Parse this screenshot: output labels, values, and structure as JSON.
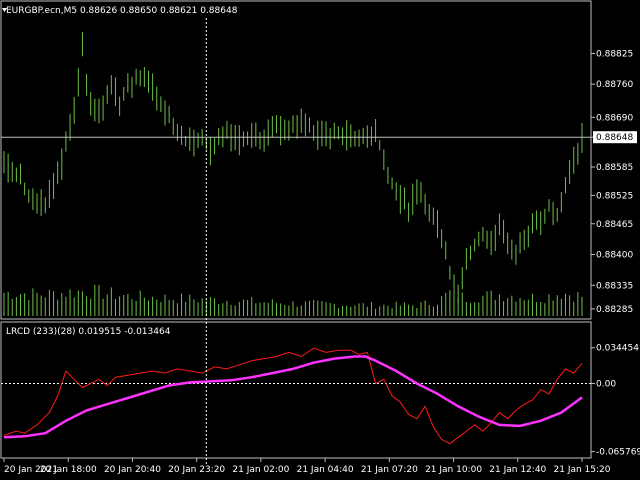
{
  "colors": {
    "background": "#000000",
    "grid_frame": "#c0c0c0",
    "candles": "#6fbf4a",
    "volume": "#6fbf4a",
    "price_line": "#c0c0c0",
    "crosshair": "#ffffff",
    "lrcd_line": "#ff1a1a",
    "signal_line": "#ff33ff",
    "price_label_bg": "#ffffff",
    "price_label_text": "#000000"
  },
  "main_panel": {
    "title": "EURGBP.ecn,M5  0.88626 0.88650 0.88621 0.88648",
    "current_price_label": "0.88648"
  },
  "indicator_panel": {
    "title": "LRCD (233)(28) 0.019515 -0.013464"
  },
  "chart_data": [
    {
      "type": "bar",
      "title": "EURGBP.ecn,M5  0.88626 0.88650 0.88621 0.88648",
      "series_type": "ohlc-bars",
      "ylim": [
        0.8827,
        0.889
      ],
      "y_ticks": [
        "0.88825",
        "0.88760",
        "0.88690",
        "0.88648",
        "0.88585",
        "0.88525",
        "0.88465",
        "0.88400",
        "0.88335",
        "0.88285"
      ],
      "y_tick_values": [
        0.88825,
        0.8876,
        0.8869,
        0.88648,
        0.88585,
        0.88525,
        0.88465,
        0.884,
        0.88335,
        0.88285
      ],
      "current_price": 0.88648,
      "close_path": [
        [
          0,
          0.8859
        ],
        [
          4,
          0.8857
        ],
        [
          8,
          0.8856
        ],
        [
          12,
          0.8852
        ],
        [
          16,
          0.8851
        ],
        [
          20,
          0.885
        ],
        [
          24,
          0.8855
        ],
        [
          28,
          0.8859
        ],
        [
          30,
          0.8864
        ],
        [
          34,
          0.887
        ],
        [
          36,
          0.8876
        ],
        [
          38,
          0.8884
        ],
        [
          40,
          0.8877
        ],
        [
          42,
          0.8872
        ],
        [
          46,
          0.887
        ],
        [
          50,
          0.8873
        ],
        [
          52,
          0.8876
        ],
        [
          56,
          0.8872
        ],
        [
          60,
          0.8876
        ],
        [
          64,
          0.8877
        ],
        [
          68,
          0.8877
        ],
        [
          72,
          0.8875
        ],
        [
          76,
          0.8872
        ],
        [
          80,
          0.8869
        ],
        [
          84,
          0.8866
        ],
        [
          88,
          0.8864
        ],
        [
          92,
          0.8864
        ],
        [
          96,
          0.8865
        ],
        [
          100,
          0.8862
        ],
        [
          104,
          0.8865
        ],
        [
          108,
          0.8866
        ],
        [
          112,
          0.8864
        ],
        [
          116,
          0.8864
        ],
        [
          120,
          0.8865
        ],
        [
          124,
          0.8864
        ],
        [
          128,
          0.8866
        ],
        [
          132,
          0.8867
        ],
        [
          136,
          0.8866
        ],
        [
          140,
          0.8867
        ],
        [
          144,
          0.8868
        ],
        [
          148,
          0.8867
        ],
        [
          152,
          0.8865
        ],
        [
          156,
          0.8865
        ],
        [
          160,
          0.8866
        ],
        [
          164,
          0.8865
        ],
        [
          168,
          0.8865
        ],
        [
          172,
          0.8865
        ],
        [
          176,
          0.8865
        ],
        [
          180,
          0.8866
        ],
        [
          184,
          0.886
        ],
        [
          188,
          0.8855
        ],
        [
          192,
          0.8852
        ],
        [
          196,
          0.885
        ],
        [
          200,
          0.8853
        ],
        [
          204,
          0.8851
        ],
        [
          208,
          0.8848
        ],
        [
          212,
          0.8844
        ],
        [
          216,
          0.8836
        ],
        [
          220,
          0.8832
        ],
        [
          224,
          0.8838
        ],
        [
          228,
          0.8842
        ],
        [
          232,
          0.8844
        ],
        [
          236,
          0.8842
        ],
        [
          240,
          0.8846
        ],
        [
          244,
          0.8843
        ],
        [
          248,
          0.884
        ],
        [
          252,
          0.8843
        ],
        [
          256,
          0.8846
        ],
        [
          260,
          0.8847
        ],
        [
          264,
          0.885
        ],
        [
          268,
          0.8848
        ],
        [
          272,
          0.8854
        ],
        [
          276,
          0.886
        ],
        [
          280,
          0.88648
        ]
      ],
      "volume_path": [
        [
          0,
          26
        ],
        [
          20,
          24
        ],
        [
          40,
          28
        ],
        [
          60,
          22
        ],
        [
          80,
          20
        ],
        [
          100,
          18
        ],
        [
          120,
          16
        ],
        [
          140,
          14
        ],
        [
          160,
          13
        ],
        [
          180,
          12
        ],
        [
          200,
          12
        ],
        [
          210,
          16
        ],
        [
          216,
          26
        ],
        [
          224,
          20
        ],
        [
          240,
          24
        ],
        [
          260,
          20
        ],
        [
          270,
          26
        ],
        [
          280,
          22
        ]
      ],
      "crosshair_x_index": 98
    },
    {
      "type": "line",
      "title": "LRCD (233)(28) 0.019515 -0.013464",
      "ylim": [
        -0.07,
        0.04
      ],
      "y_ticks": [
        "0.034454",
        "0.00",
        "-0.065769"
      ],
      "y_tick_values": [
        0.034454,
        0.0,
        -0.065769
      ],
      "zero_line": 0.0,
      "series": [
        {
          "name": "",
          "color": "#ff1a1a",
          "points": [
            [
              0,
              -0.05
            ],
            [
              6,
              -0.046
            ],
            [
              10,
              -0.048
            ],
            [
              16,
              -0.04
            ],
            [
              22,
              -0.028
            ],
            [
              26,
              -0.012
            ],
            [
              30,
              0.012
            ],
            [
              34,
              0.004
            ],
            [
              38,
              -0.004
            ],
            [
              42,
              0.0
            ],
            [
              46,
              0.004
            ],
            [
              50,
              -0.002
            ],
            [
              54,
              0.006
            ],
            [
              60,
              0.008
            ],
            [
              66,
              0.01
            ],
            [
              72,
              0.012
            ],
            [
              78,
              0.01
            ],
            [
              84,
              0.014
            ],
            [
              90,
              0.012
            ],
            [
              96,
              0.01
            ],
            [
              102,
              0.016
            ],
            [
              108,
              0.014
            ],
            [
              114,
              0.018
            ],
            [
              120,
              0.022
            ],
            [
              126,
              0.024
            ],
            [
              132,
              0.026
            ],
            [
              138,
              0.03
            ],
            [
              144,
              0.026
            ],
            [
              150,
              0.034
            ],
            [
              156,
              0.03
            ],
            [
              162,
              0.032
            ],
            [
              168,
              0.032
            ],
            [
              172,
              0.028
            ],
            [
              176,
              0.03
            ],
            [
              180,
              0.0
            ],
            [
              184,
              0.004
            ],
            [
              188,
              -0.012
            ],
            [
              192,
              -0.018
            ],
            [
              196,
              -0.03
            ],
            [
              200,
              -0.034
            ],
            [
              204,
              -0.022
            ],
            [
              208,
              -0.042
            ],
            [
              212,
              -0.054
            ],
            [
              216,
              -0.058
            ],
            [
              220,
              -0.052
            ],
            [
              224,
              -0.046
            ],
            [
              228,
              -0.04
            ],
            [
              232,
              -0.046
            ],
            [
              236,
              -0.038
            ],
            [
              240,
              -0.028
            ],
            [
              244,
              -0.034
            ],
            [
              248,
              -0.026
            ],
            [
              252,
              -0.02
            ],
            [
              256,
              -0.016
            ],
            [
              260,
              -0.006
            ],
            [
              264,
              -0.01
            ],
            [
              268,
              0.004
            ],
            [
              272,
              0.014
            ],
            [
              276,
              0.01
            ],
            [
              280,
              0.019515
            ]
          ]
        },
        {
          "name": "",
          "color": "#ff33ff",
          "points": [
            [
              0,
              -0.052
            ],
            [
              10,
              -0.051
            ],
            [
              20,
              -0.048
            ],
            [
              30,
              -0.036
            ],
            [
              40,
              -0.026
            ],
            [
              50,
              -0.02
            ],
            [
              60,
              -0.014
            ],
            [
              70,
              -0.008
            ],
            [
              80,
              -0.002
            ],
            [
              90,
              0.001
            ],
            [
              100,
              0.002
            ],
            [
              110,
              0.003
            ],
            [
              120,
              0.006
            ],
            [
              130,
              0.01
            ],
            [
              140,
              0.014
            ],
            [
              150,
              0.02
            ],
            [
              160,
              0.024
            ],
            [
              170,
              0.026
            ],
            [
              175,
              0.026
            ],
            [
              180,
              0.022
            ],
            [
              190,
              0.012
            ],
            [
              200,
              0.0
            ],
            [
              210,
              -0.01
            ],
            [
              220,
              -0.022
            ],
            [
              230,
              -0.032
            ],
            [
              240,
              -0.04
            ],
            [
              250,
              -0.041
            ],
            [
              260,
              -0.036
            ],
            [
              270,
              -0.028
            ],
            [
              280,
              -0.013464
            ]
          ]
        }
      ]
    },
    {
      "type": "table",
      "x_tick_labels": [
        "20 Jan 2021",
        "20 Jan 18:00",
        "20 Jan 20:40",
        "20 Jan 23:20",
        "21 Jan 02:00",
        "21 Jan 04:40",
        "21 Jan 07:20",
        "21 Jan 10:00",
        "21 Jan 12:40",
        "21 Jan 15:20"
      ]
    }
  ]
}
